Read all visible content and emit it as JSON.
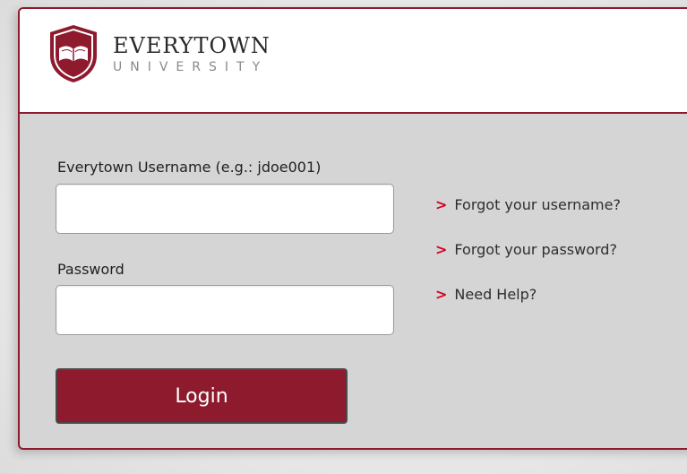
{
  "brand": {
    "name": "EVERYTOWN",
    "subtitle": "UNIVERSITY",
    "colors": {
      "primary": "#8e1a2e",
      "link_marker": "#d4001f",
      "panel_bg": "#d6d5d5"
    }
  },
  "form": {
    "username_label": "Everytown Username (e.g.: jdoe001)",
    "username_value": "",
    "password_label": "Password",
    "password_value": "",
    "login_label": "Login"
  },
  "help_links": [
    {
      "marker": ">",
      "label": "Forgot your username?"
    },
    {
      "marker": ">",
      "label": "Forgot your password?"
    },
    {
      "marker": ">",
      "label": "Need Help?"
    }
  ]
}
